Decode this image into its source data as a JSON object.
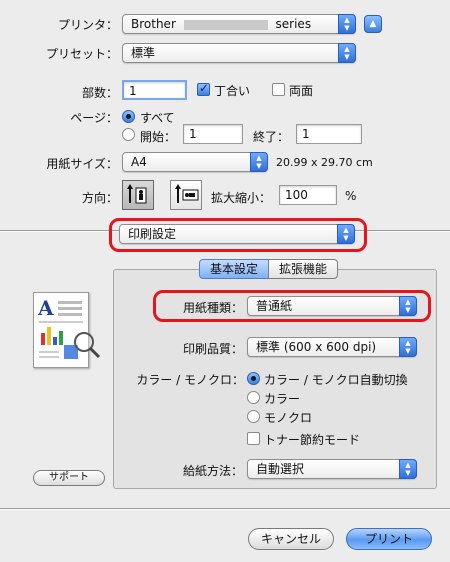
{
  "printer": {
    "label": "プリンタ：",
    "value_prefix": "Brother",
    "value_suffix": "series"
  },
  "presets": {
    "label": "プリセット：",
    "value": "標準"
  },
  "copies": {
    "label": "部数：",
    "value": "1",
    "collated_label": "丁合い",
    "collated": true,
    "duplex_label": "両面",
    "duplex": false
  },
  "pages": {
    "label": "ページ：",
    "all_label": "すべて",
    "from_label": "開始：",
    "from_value": "1",
    "to_label": "終了：",
    "to_value": "1",
    "selected": "all"
  },
  "paper_size": {
    "label": "用紙サイズ：",
    "value": "A4",
    "dimensions": "20.99 x 29.70 cm"
  },
  "orientation": {
    "label": "方向：",
    "selected": "portrait"
  },
  "scale": {
    "label": "拡大縮小：",
    "value": "100",
    "unit": "%"
  },
  "panel_select": {
    "value": "印刷設定"
  },
  "tabs": {
    "basic": "基本設定",
    "advanced": "拡張機能",
    "selected": "basic"
  },
  "media_type": {
    "label": "用紙種類：",
    "value": "普通紙"
  },
  "print_quality": {
    "label": "印刷品質：",
    "value": "標準 (600 x 600 dpi)"
  },
  "color_mode": {
    "label": "カラー / モノクロ：",
    "options": [
      "カラー / モノクロ自動切換",
      "カラー",
      "モノクロ"
    ],
    "selected_index": 0
  },
  "toner_save": {
    "label": "トナー節約モード",
    "checked": false
  },
  "paper_source": {
    "label": "給紙方法：",
    "value": "自動選択"
  },
  "support_button": "サポート",
  "cancel_button": "キャンセル",
  "print_button": "プリント",
  "colors": {
    "accent": "#3b7fe0",
    "highlight": "#e8141c"
  }
}
